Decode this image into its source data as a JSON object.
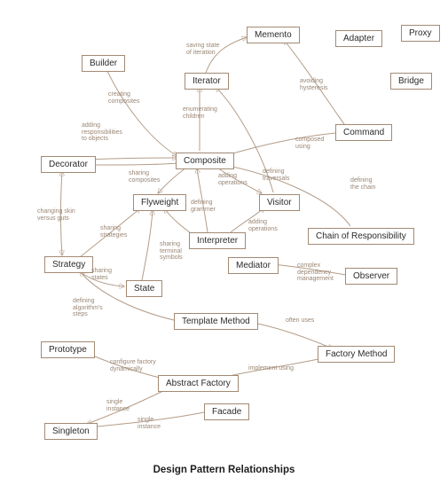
{
  "title": "Design Pattern Relationships",
  "nodes": {
    "memento": "Memento",
    "adapter": "Adapter",
    "proxy": "Proxy",
    "builder": "Builder",
    "iterator": "Iterator",
    "bridge": "Bridge",
    "command": "Command",
    "composite": "Composite",
    "decorator": "Decorator",
    "flyweight": "Flyweight",
    "visitor": "Visitor",
    "interpreter": "Interpreter",
    "chain": "Chain of Responsibility",
    "strategy": "Strategy",
    "state": "State",
    "mediator": "Mediator",
    "observer": "Observer",
    "template": "Template Method",
    "prototype": "Prototype",
    "factory": "Factory Method",
    "abstract_factory": "Abstract Factory",
    "singleton": "Singleton",
    "facade": "Facade"
  },
  "edge_labels": {
    "saving_state": "saving state\nof iteration",
    "creating_composites": "creating\ncomposites",
    "avoiding_hysteresis": "avoiding\nhysteresis",
    "adding_resp": "adding\nresponsibilities\nto objects",
    "enumerating": "enumerating\nchildren",
    "composed_using": "composed\nusing",
    "sharing_composites": "sharing\ncomposites",
    "adding_ops1": "adding\noperations",
    "defining_traversals": "defining\ntraversals",
    "defining_chain": "defining\nthe chain",
    "defining_grammer": "defining\ngrammer",
    "adding_ops2": "adding\noperations",
    "changing_skin": "changing skin\nversus guts",
    "sharing_strategies": "sharing\nstrategies",
    "sharing_terminal": "sharing\nterminal\nsymbols",
    "sharing_states": "sharing\nstates",
    "complex_dep": "complex\ndependency\nmanagement",
    "defining_alg": "defining\nalgorithm's\nsteps",
    "often_uses": "often uses",
    "configure_factory": "configure factory\ndynamically",
    "implement_using": "implement using",
    "single_instance1": "single\ninstance",
    "single_instance2": "single\ninstance"
  }
}
